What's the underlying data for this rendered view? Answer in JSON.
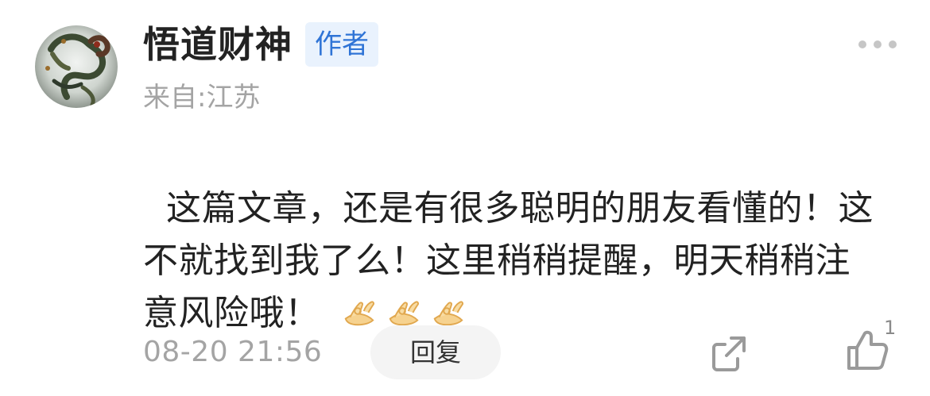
{
  "comment": {
    "username": "悟道财神",
    "author_badge": "作者",
    "location": "来自:江苏",
    "text": "这篇文章，还是有很多聪明的朋友看懂的！这不就找到我了么！这里稍稍提醒，明天稍稍注意风险哦！",
    "emojis": [
      "ok-hand-emoji",
      "ok-hand-emoji",
      "ok-hand-emoji"
    ],
    "timestamp": "08-20 21:56",
    "reply_label": "回复",
    "like_count": "1"
  },
  "icons": {
    "avatar": "dragon-avatar",
    "more": "more-dots-icon",
    "share": "share-icon",
    "like": "thumbs-up-icon"
  },
  "colors": {
    "badge_bg": "#e9f2fd",
    "badge_text": "#2f74d6",
    "muted_text": "#a4a4a4",
    "body_text": "#222222",
    "reply_bg": "#f4f4f4"
  }
}
